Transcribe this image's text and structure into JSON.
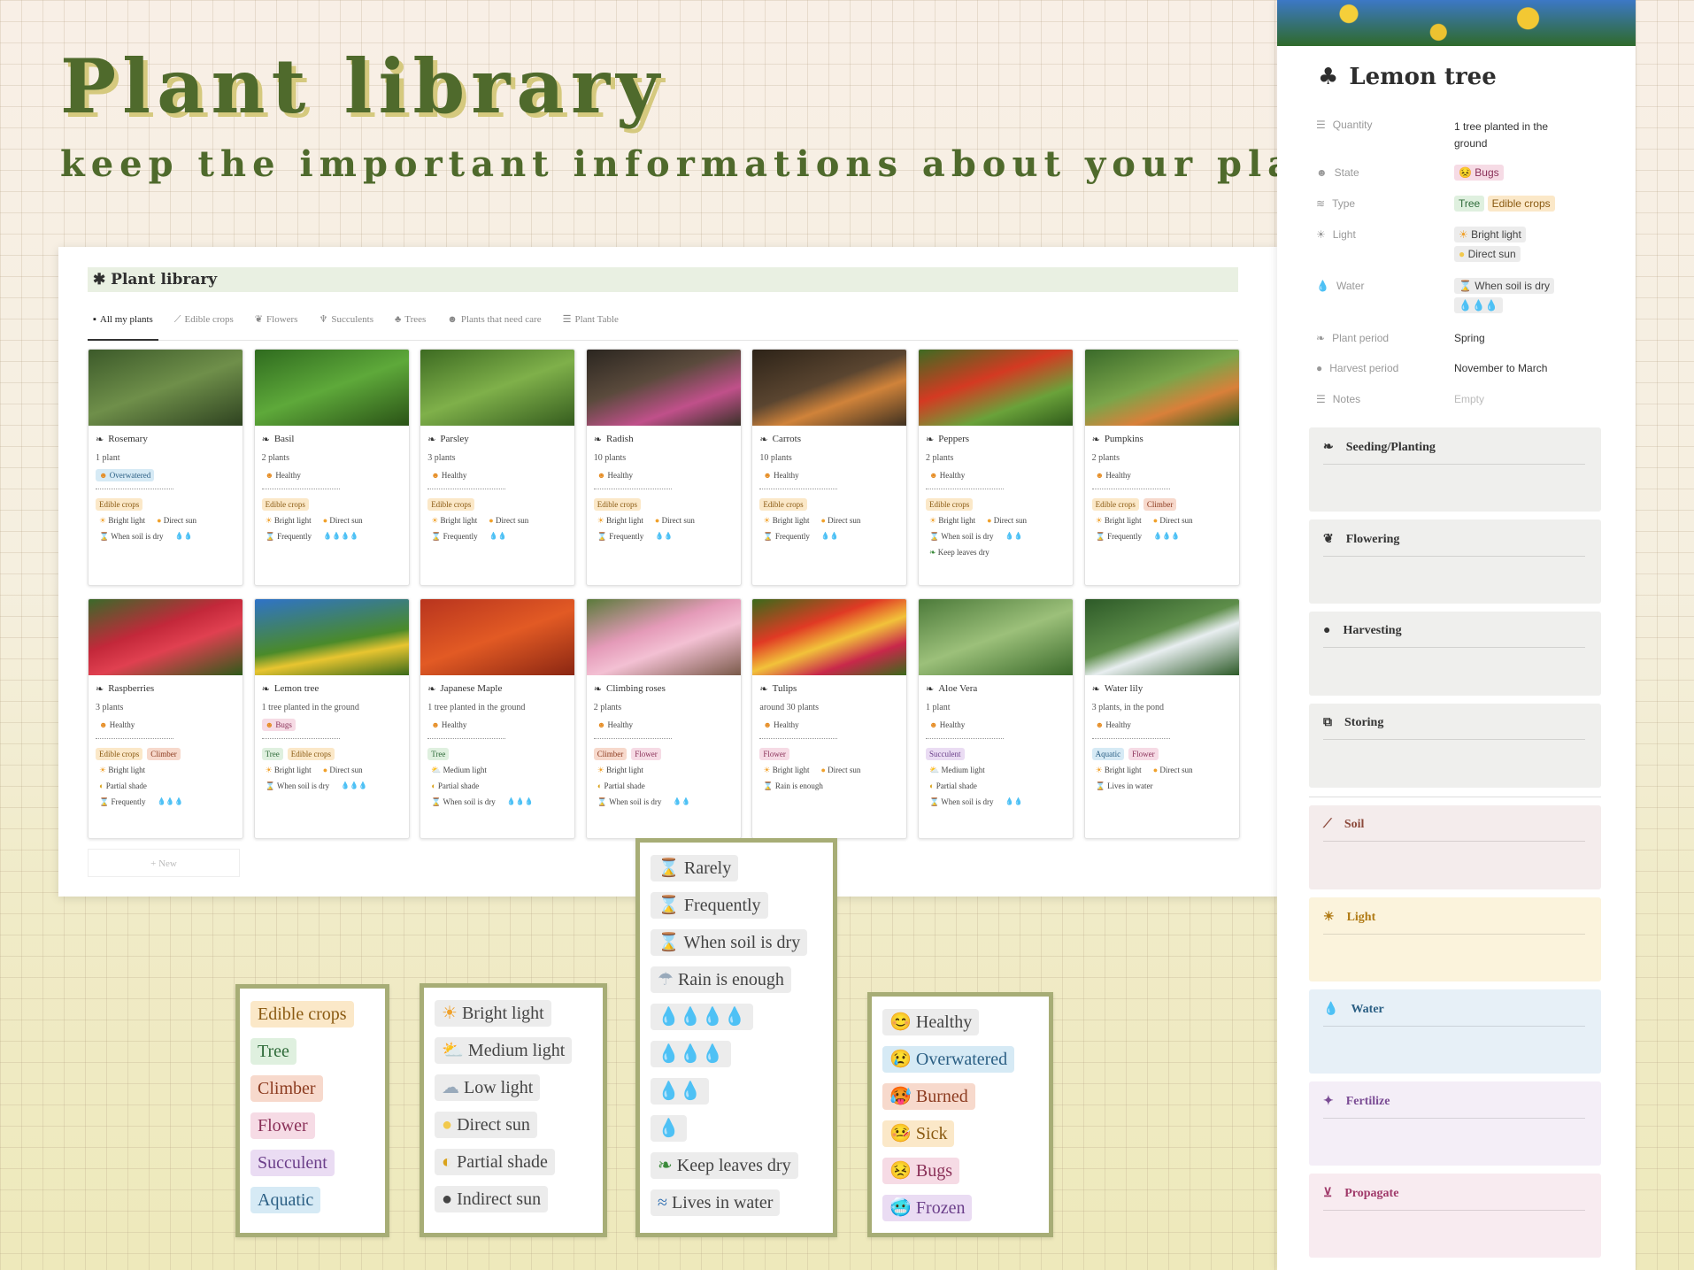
{
  "hero": {
    "title": "Plant library",
    "subtitle": "keep the important informations about your plants"
  },
  "library": {
    "title": "Plant library",
    "tabs": [
      {
        "icon": "book-icon",
        "label": "All my plants"
      },
      {
        "icon": "carrot-icon",
        "label": "Edible crops"
      },
      {
        "icon": "flower-icon",
        "label": "Flowers"
      },
      {
        "icon": "cactus-icon",
        "label": "Succulents"
      },
      {
        "icon": "tree-icon",
        "label": "Trees"
      },
      {
        "icon": "face-icon",
        "label": "Plants that need care"
      },
      {
        "icon": "list-icon",
        "label": "Plant Table"
      }
    ],
    "new_label": "+ New",
    "plants": [
      {
        "name": "Rosemary",
        "qty": "1 plant",
        "state": "Overwatered",
        "types": [
          "Edible crops"
        ],
        "light": [
          "Bright light",
          "Direct sun"
        ],
        "water": "When soil is dry",
        "drops": "💧💧"
      },
      {
        "name": "Basil",
        "qty": "2 plants",
        "state": "Healthy",
        "types": [
          "Edible crops"
        ],
        "light": [
          "Bright light",
          "Direct sun"
        ],
        "water": "Frequently",
        "drops": "💧💧💧💧"
      },
      {
        "name": "Parsley",
        "qty": "3 plants",
        "state": "Healthy",
        "types": [
          "Edible crops"
        ],
        "light": [
          "Bright light",
          "Direct sun"
        ],
        "water": "Frequently",
        "drops": "💧💧"
      },
      {
        "name": "Radish",
        "qty": "10 plants",
        "state": "Healthy",
        "types": [
          "Edible crops"
        ],
        "light": [
          "Bright light",
          "Direct sun"
        ],
        "water": "Frequently",
        "drops": "💧💧"
      },
      {
        "name": "Carrots",
        "qty": "10 plants",
        "state": "Healthy",
        "types": [
          "Edible crops"
        ],
        "light": [
          "Bright light",
          "Direct sun"
        ],
        "water": "Frequently",
        "drops": "💧💧"
      },
      {
        "name": "Peppers",
        "qty": "2 plants",
        "state": "Healthy",
        "types": [
          "Edible crops"
        ],
        "light": [
          "Bright light",
          "Direct sun"
        ],
        "water": "When soil is dry",
        "drops": "💧💧",
        "extra": "Keep leaves dry"
      },
      {
        "name": "Pumpkins",
        "qty": "2 plants",
        "state": "Healthy",
        "types": [
          "Edible crops",
          "Climber"
        ],
        "light": [
          "Bright light",
          "Direct sun"
        ],
        "water": "Frequently",
        "drops": "💧💧💧"
      },
      {
        "name": "Raspberries",
        "qty": "3 plants",
        "state": "Healthy",
        "types": [
          "Edible crops",
          "Climber"
        ],
        "light": [
          "Bright light"
        ],
        "light2": "Partial shade",
        "water": "Frequently",
        "drops": "💧💧💧"
      },
      {
        "name": "Lemon tree",
        "qty": "1 tree planted in the ground",
        "state": "Bugs",
        "types": [
          "Tree",
          "Edible crops"
        ],
        "light": [
          "Bright light",
          "Direct sun"
        ],
        "water": "When soil is dry",
        "drops": "💧💧💧"
      },
      {
        "name": "Japanese Maple",
        "qty": "1 tree planted in the ground",
        "state": "Healthy",
        "types": [
          "Tree"
        ],
        "light": [
          "Medium light"
        ],
        "light2": "Partial shade",
        "water": "When soil is dry",
        "drops": "💧💧💧"
      },
      {
        "name": "Climbing roses",
        "qty": "2 plants",
        "state": "Healthy",
        "types": [
          "Climber",
          "Flower"
        ],
        "light": [
          "Bright light"
        ],
        "light2": "Partial shade",
        "water": "When soil is dry",
        "drops": "💧💧"
      },
      {
        "name": "Tulips",
        "qty": "around 30 plants",
        "state": "Healthy",
        "types": [
          "Flower"
        ],
        "light": [
          "Bright light",
          "Direct sun"
        ],
        "water": "Rain is enough",
        "drops": ""
      },
      {
        "name": "Aloe Vera",
        "qty": "1 plant",
        "state": "Healthy",
        "types": [
          "Succulent"
        ],
        "light": [
          "Medium light"
        ],
        "light2": "Partial shade",
        "water": "When soil is dry",
        "drops": "💧💧"
      },
      {
        "name": "Water lily",
        "qty": "3 plants, in the pond",
        "state": "Healthy",
        "types": [
          "Aquatic",
          "Flower"
        ],
        "light": [
          "Bright light",
          "Direct sun"
        ],
        "water": "Lives in water",
        "drops": ""
      }
    ]
  },
  "detail": {
    "title": "Lemon tree",
    "props": {
      "quantity_label": "Quantity",
      "quantity_value": "1 tree planted in the ground",
      "state_label": "State",
      "state_value": "Bugs",
      "type_label": "Type",
      "type_values": [
        "Tree",
        "Edible crops"
      ],
      "light_label": "Light",
      "light_values": [
        "Bright light",
        "Direct sun"
      ],
      "water_label": "Water",
      "water_value": "When soil is dry",
      "water_drops": "💧💧💧",
      "plant_period_label": "Plant period",
      "plant_period_value": "Spring",
      "harvest_label": "Harvest period",
      "harvest_value": "November to March",
      "notes_label": "Notes",
      "notes_value": "Empty"
    },
    "sections": [
      "Seeding/Planting",
      "Flowering",
      "Harvesting",
      "Storing",
      "Soil",
      "Light",
      "Water",
      "Fertilize",
      "Propagate"
    ]
  },
  "legends": {
    "types": [
      "Edible crops",
      "Tree",
      "Climber",
      "Flower",
      "Succulent",
      "Aquatic"
    ],
    "light": [
      "Bright light",
      "Medium light",
      "Low light",
      "Direct sun",
      "Partial shade",
      "Indirect sun"
    ],
    "water": [
      "Rarely",
      "Frequently",
      "When soil is dry",
      "Rain is enough",
      "💧💧💧💧",
      "💧💧💧",
      "💧💧",
      "💧",
      "Keep leaves dry",
      "Lives in water"
    ],
    "state": [
      "Healthy",
      "Overwatered",
      "Burned",
      "Sick",
      "Bugs",
      "Frozen"
    ]
  },
  "colors": {
    "title_green": "#4f6a2c",
    "legend_border": "#a7ad76"
  }
}
